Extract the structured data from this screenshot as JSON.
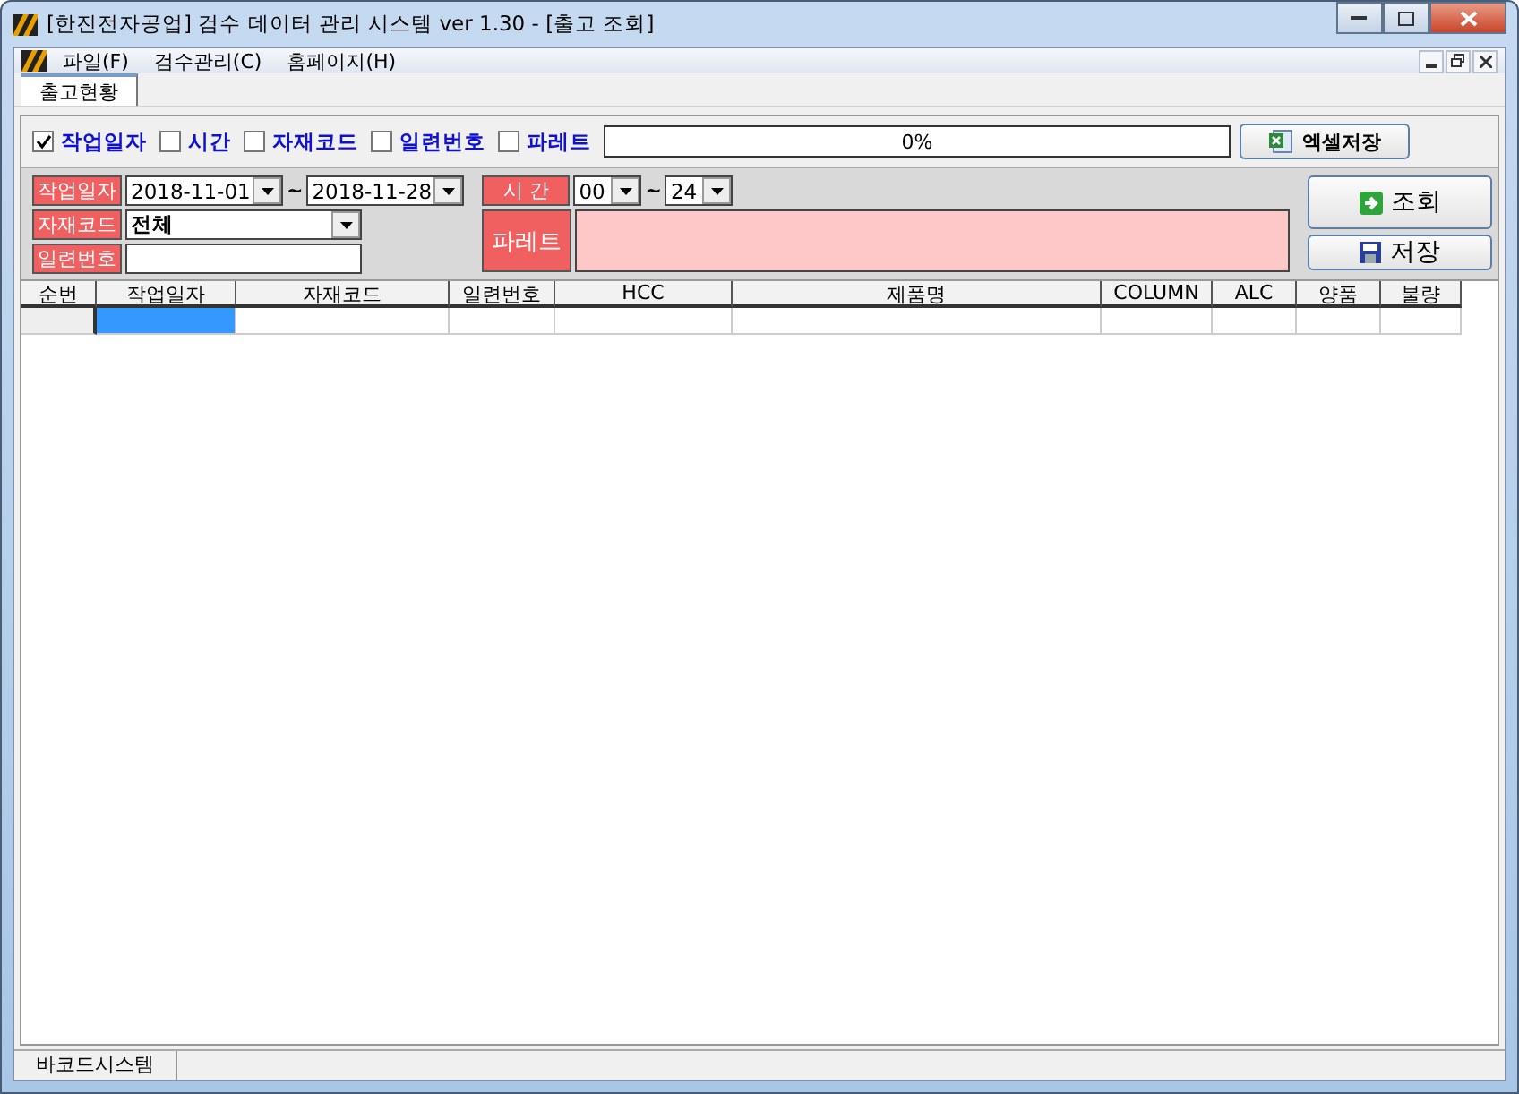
{
  "window": {
    "title": "[한진전자공업] 검수 데이터 관리 시스템 ver 1.30 - [출고 조회]"
  },
  "menu": [
    "파일(F)",
    "검수관리(C)",
    "홈페이지(H)"
  ],
  "tabs": [
    {
      "label": "출고현황",
      "selected": true
    }
  ],
  "filters": [
    {
      "label": "작업일자",
      "checked": true
    },
    {
      "label": "시간",
      "checked": false
    },
    {
      "label": "자재코드",
      "checked": false
    },
    {
      "label": "일련번호",
      "checked": false
    },
    {
      "label": "파레트",
      "checked": false
    }
  ],
  "progress": {
    "label": "0%",
    "level": 0
  },
  "excel_button": "엑셀저장",
  "form": {
    "date_label": "작업일자",
    "date_from": "2018-11-01",
    "date_to": "2018-11-28",
    "tilde": "~",
    "time_label": "시 간",
    "time_from": "00",
    "time_to": "24",
    "code_label": "자재코드",
    "code_value": "전체",
    "serial_label": "일련번호",
    "pallet_label": "파레트"
  },
  "buttons": [
    "조회",
    "저장"
  ],
  "table": {
    "columns": [
      "순번",
      "작업일자",
      "자재코드",
      "일련번호",
      "HCC",
      "제품명",
      "COLUMN",
      "ALC",
      "양품",
      "불량"
    ]
  },
  "status_bar": [
    "바코드시스템"
  ]
}
